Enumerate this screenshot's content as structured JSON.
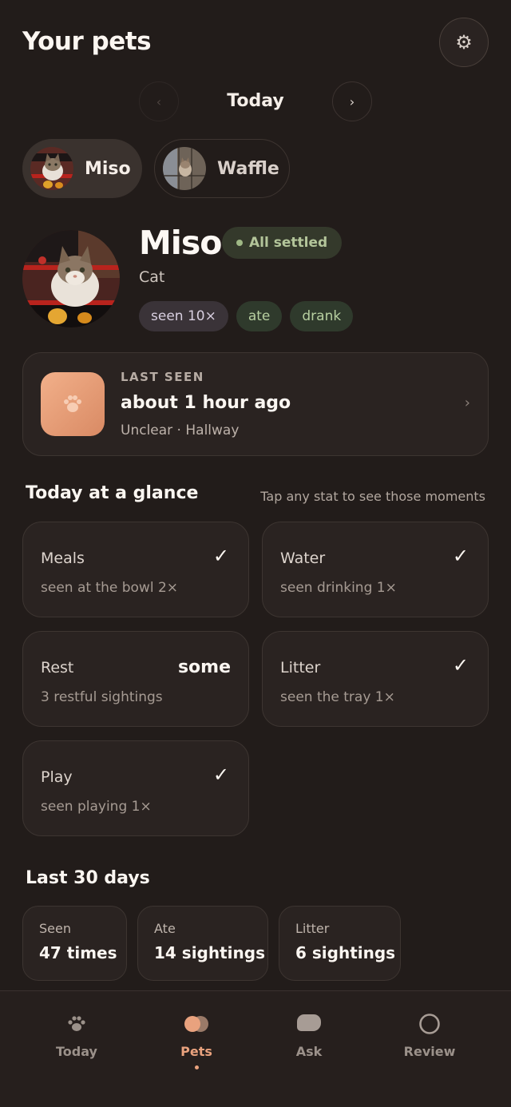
{
  "header": {
    "title": "Your pets",
    "settings_icon": "gear-icon"
  },
  "date_nav": {
    "label": "Today",
    "prev_icon": "‹",
    "next_icon": "›"
  },
  "pets": [
    {
      "name": "Miso",
      "selected": true
    },
    {
      "name": "Waffle",
      "selected": false
    }
  ],
  "profile": {
    "name": "Miso",
    "status": "All settled",
    "species": "Cat",
    "tags": [
      "seen 10×",
      "ate",
      "drank"
    ]
  },
  "last_seen": {
    "kicker": "LAST SEEN",
    "time": "about 1 hour ago",
    "detail": "Unclear · Hallway",
    "chevron": "›"
  },
  "glance": {
    "title": "Today at a glance",
    "hint": "Tap any stat to see those moments",
    "stats": [
      {
        "label": "Meals",
        "sub": "seen at the bowl 2×",
        "mark": "✓"
      },
      {
        "label": "Water",
        "sub": "seen drinking 1×",
        "mark": "✓"
      },
      {
        "label": "Rest",
        "sub": "3 restful sightings",
        "value": "some"
      },
      {
        "label": "Litter",
        "sub": "seen the tray 1×",
        "mark": "✓"
      },
      {
        "label": "Play",
        "sub": "seen playing 1×",
        "mark": "✓"
      }
    ]
  },
  "last_30_days": {
    "title": "Last 30 days",
    "items": [
      {
        "label": "Seen",
        "value": "47 times"
      },
      {
        "label": "Ate",
        "value": "14 sightings"
      },
      {
        "label": "Litter",
        "value": "6 sightings"
      }
    ]
  },
  "bottom_nav": {
    "items": [
      {
        "label": "Today",
        "icon": "paw-icon"
      },
      {
        "label": "Pets",
        "icon": "pets-icon",
        "active": true
      },
      {
        "label": "Ask",
        "icon": "chat-bubble-icon"
      },
      {
        "label": "Review",
        "icon": "circle-icon"
      }
    ]
  },
  "colors": {
    "accent": "#e9a27e",
    "background": "#221c1a",
    "card": "#2a2321",
    "status_green": "#b3c59a"
  }
}
